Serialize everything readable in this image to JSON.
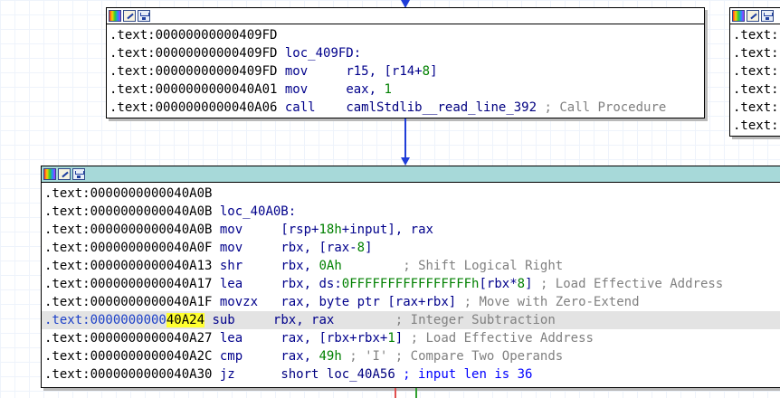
{
  "node_top": {
    "lines": [
      {
        "addr": ".text:00000000000409FD",
        "mnem": "",
        "ops": "",
        "comment": ""
      },
      {
        "addr": ".text:00000000000409FD",
        "mnem": "loc_409FD:",
        "ops": "",
        "comment": ""
      },
      {
        "addr": ".text:00000000000409FD",
        "mnem": "mov",
        "ops_a": "r15, [r14+",
        "ops_num": "8",
        "ops_b": "]",
        "comment": ""
      },
      {
        "addr": ".text:0000000000040A01",
        "mnem": "mov",
        "ops_a": "eax, ",
        "ops_num": "1",
        "ops_b": "",
        "comment": ""
      },
      {
        "addr": ".text:0000000000040A06",
        "mnem": "call",
        "ops": "camlStdlib__read_line_392",
        "comment": "; Call Procedure"
      }
    ]
  },
  "node_right": {
    "lines": [
      ".text:",
      ".text:",
      ".text:",
      ".text:",
      ".text:",
      ".text:"
    ]
  },
  "node_main": {
    "lines": {
      "l0": {
        "addr": ".text:0000000000040A0B"
      },
      "l1": {
        "addr": ".text:0000000000040A0B",
        "label": "loc_40A0B:"
      },
      "l2": {
        "addr": ".text:0000000000040A0B",
        "mnem": "mov",
        "ops_a": "[rsp+",
        "ops_num": "18h",
        "ops_b": "+input], rax"
      },
      "l3": {
        "addr": ".text:0000000000040A0F",
        "mnem": "mov",
        "ops_a": "rbx, [rax-",
        "ops_num": "8",
        "ops_b": "]"
      },
      "l4": {
        "addr": ".text:0000000000040A13",
        "mnem": "shr",
        "ops_a": "rbx, ",
        "ops_num": "0Ah",
        "pad": "        ",
        "comment": "; Shift Logical Right"
      },
      "l5": {
        "addr": ".text:0000000000040A17",
        "mnem": "lea",
        "ops_a": "rbx, ds:",
        "ops_num": "0FFFFFFFFFFFFFFFFh",
        "ops_b": "[rbx*",
        "ops_num2": "8",
        "ops_c": "]",
        "comment": " ; Load Effective Address"
      },
      "l6": {
        "addr": ".text:0000000000040A1F",
        "mnem": "movzx",
        "ops_a": "rax, byte ptr [rax+rbx]",
        "comment": " ; Move with Zero-Extend"
      },
      "l7": {
        "addr_pre": ".text:0000000000",
        "addr_hl": "40A24",
        "mnem": "sub",
        "ops_a": "rbx, rax",
        "pad": "       ",
        "comment": " ; Integer Subtraction"
      },
      "l8": {
        "addr": ".text:0000000000040A27",
        "mnem": "lea",
        "ops_a": "rax, [rbx+rbx+",
        "ops_num": "1",
        "ops_b": "]",
        "comment": " ; Load Effective Address"
      },
      "l9": {
        "addr": ".text:0000000000040A2C",
        "mnem": "cmp",
        "ops_a": "rax, ",
        "ops_num": "49h",
        "ops_b": " ; 'I'",
        "comment": " ; Compare Two Operands"
      },
      "l10": {
        "addr": ".text:0000000000040A30",
        "mnem": "jz",
        "ops_a": "short loc_40A56",
        "comment": " ; input len is 36"
      }
    }
  },
  "colors": {
    "edge": "#1f3dd8",
    "active_header": "#a7d9d9",
    "highlight_line": "#e3e3e3",
    "highlight_addr": "#ffff30"
  },
  "icons": [
    "color-palette-icon",
    "rename-icon",
    "graph-icon"
  ]
}
